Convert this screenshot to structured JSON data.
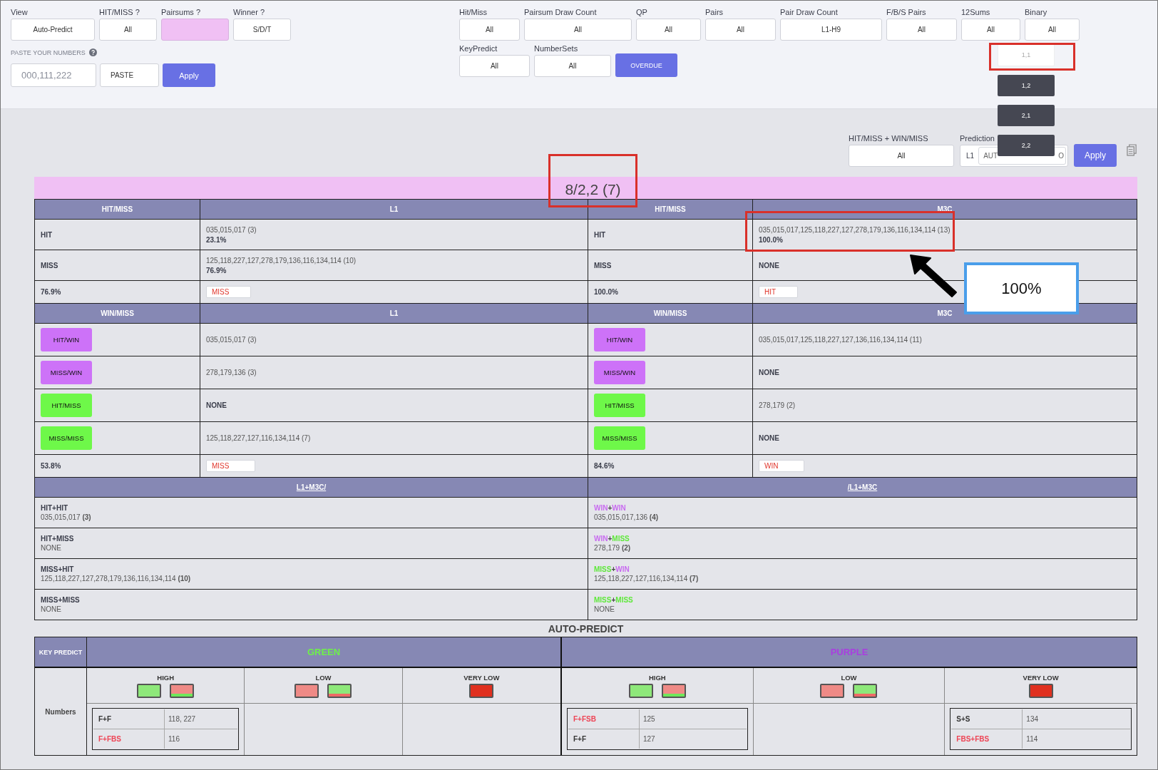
{
  "filters_left": [
    {
      "label": "View",
      "kind": "select",
      "value": "Auto-Predict"
    },
    {
      "label": "HIT/MISS ?",
      "kind": "select",
      "value": "All"
    },
    {
      "label": "Pairsums ?",
      "kind": "swatch"
    },
    {
      "label": "Winner ?",
      "kind": "select",
      "value": "S/D/T"
    }
  ],
  "paste": {
    "label": "PASTE YOUR NUMBERS",
    "placeholder": "000,111,222",
    "paste_button": "PASTE",
    "apply_button": "Apply"
  },
  "filters_right": [
    {
      "label": "Hit/Miss",
      "value": "All"
    },
    {
      "label": "Pairsum Draw Count",
      "value": "All"
    },
    {
      "label": "QP",
      "value": "All"
    },
    {
      "label": "Pairs",
      "value": "All"
    },
    {
      "label": "Pair Draw Count",
      "value": "L1-H9"
    },
    {
      "label": "F/B/S Pairs",
      "value": "All"
    },
    {
      "label": "12Sums",
      "value": "All"
    },
    {
      "label": "Binary",
      "value": "All"
    }
  ],
  "filters_right_row2": [
    {
      "label": "KeyPredict",
      "value": "All"
    },
    {
      "label": "NumberSets",
      "value": "All"
    }
  ],
  "overdue_button": "OVERDUE",
  "dropdown": {
    "options": [
      {
        "label": "1,1",
        "selected": true
      },
      {
        "label": "1,2",
        "selected": false
      },
      {
        "label": "2,1",
        "selected": false
      },
      {
        "label": "2,2",
        "selected": false
      }
    ]
  },
  "result_filter": {
    "label": "HIT/MISS + WIN/MISS",
    "value": "All"
  },
  "prediction": {
    "label": "Prediction",
    "prefix": "L1",
    "value_start": "AUT",
    "value_end": "O",
    "apply_button": "Apply"
  },
  "summary_title": "8/2,2 (7)",
  "sides": [
    {
      "hit_name": "L1",
      "win_name": "L1",
      "hit_header": "HIT/MISS",
      "hit_rows": [
        {
          "label": "HIT",
          "numbers": "035,015,017 (3)",
          "percent": "23.1%",
          "empty": false
        },
        {
          "label": "MISS",
          "numbers": "125,118,227,127,278,179,136,116,134,114 (10)",
          "percent": "76.9%",
          "empty": false
        }
      ],
      "hit_total": "76.9%",
      "hit_result": "MISS",
      "win_header": "WIN/MISS",
      "win_rows": [
        {
          "label": "HIT/WIN",
          "kind": "win",
          "numbers": "035,015,017 (3)",
          "empty": false
        },
        {
          "label": "MISS/WIN",
          "kind": "win",
          "numbers": "278,179,136 (3)",
          "empty": false
        },
        {
          "label": "HIT/MISS",
          "kind": "miss",
          "numbers": "NONE",
          "empty": true
        },
        {
          "label": "MISS/MISS",
          "kind": "miss",
          "numbers": "125,118,227,127,116,134,114 (7)",
          "empty": false
        }
      ],
      "win_total": "53.8%",
      "win_result": "MISS"
    },
    {
      "hit_name": "M3C",
      "win_name": "M3C",
      "hit_header": "HIT/MISS",
      "hit_rows": [
        {
          "label": "HIT",
          "numbers": "035,015,017,125,118,227,127,278,179,136,116,134,114 (13)",
          "percent": "100.0%",
          "empty": false
        },
        {
          "label": "MISS",
          "numbers": "NONE",
          "empty": true
        }
      ],
      "hit_total": "100.0%",
      "hit_result": "HIT",
      "win_header": "WIN/MISS",
      "win_rows": [
        {
          "label": "HIT/WIN",
          "kind": "win",
          "numbers": "035,015,017,125,118,227,127,136,116,134,114 (11)",
          "empty": false
        },
        {
          "label": "MISS/WIN",
          "kind": "win",
          "numbers": "NONE",
          "empty": true
        },
        {
          "label": "HIT/MISS",
          "kind": "miss",
          "numbers": "278,179 (2)",
          "empty": false
        },
        {
          "label": "MISS/MISS",
          "kind": "miss",
          "numbers": "NONE",
          "empty": true
        }
      ],
      "win_total": "84.6%",
      "win_result": "WIN"
    }
  ],
  "combo": {
    "left_header": "L1+M3C/",
    "right_header": "/L1+M3C",
    "left_rows": [
      {
        "label": "HIT+HIT",
        "numbers": "035,015,017 **(3)**"
      },
      {
        "label": "HIT+MISS",
        "numbers": "NONE"
      },
      {
        "label": "MISS+HIT",
        "numbers": "125,118,227,127,278,179,136,116,134,114 **(10)**"
      },
      {
        "label": "MISS+MISS",
        "numbers": "NONE"
      }
    ],
    "right_rows": [
      {
        "parts": [
          {
            "text": "WIN",
            "kind": "win"
          },
          {
            "text": "+",
            "kind": "plus"
          },
          {
            "text": "WIN",
            "kind": "win"
          }
        ],
        "numbers": "035,015,017,136 **(4)**"
      },
      {
        "parts": [
          {
            "text": "WIN",
            "kind": "win"
          },
          {
            "text": "+",
            "kind": "plus"
          },
          {
            "text": "MISS",
            "kind": "miss"
          }
        ],
        "numbers": "278,179 **(2)**"
      },
      {
        "parts": [
          {
            "text": "MISS",
            "kind": "miss"
          },
          {
            "text": "+",
            "kind": "plus"
          },
          {
            "text": "WIN",
            "kind": "win"
          }
        ],
        "numbers": "125,118,227,127,116,134,114 **(7)**"
      },
      {
        "parts": [
          {
            "text": "MISS",
            "kind": "miss"
          },
          {
            "text": "+",
            "kind": "plus"
          },
          {
            "text": "MISS",
            "kind": "miss"
          }
        ],
        "numbers": "NONE"
      }
    ]
  },
  "auto_predict": {
    "title": "AUTO-PREDICT",
    "key_header": "KEY PREDICT",
    "row_label": "Numbers",
    "groups": [
      {
        "name": "GREEN",
        "color": "#6ef04a",
        "levels": [
          {
            "label": "HIGH",
            "swatches": [
              {
                "kind": "green"
              },
              {
                "kind": "red_low"
              }
            ],
            "entries": [
              {
                "code": "F+F",
                "alert": false,
                "numbers": "118, 227"
              },
              {
                "code": "F+FBS",
                "alert": true,
                "numbers": "116"
              }
            ]
          },
          {
            "label": "LOW",
            "swatches": [
              {
                "kind": "red"
              },
              {
                "kind": "green_low"
              }
            ]
          },
          {
            "label": "VERY LOW",
            "swatches": [
              {
                "kind": "dark_red"
              }
            ]
          }
        ]
      },
      {
        "name": "PURPLE",
        "color": "#a93ee0",
        "levels": [
          {
            "label": "HIGH",
            "swatches": [
              {
                "kind": "green"
              },
              {
                "kind": "red_low"
              }
            ],
            "entries": [
              {
                "code": "F+FSB",
                "alert": true,
                "numbers": "125"
              },
              {
                "code": "F+F",
                "alert": false,
                "numbers": "127"
              }
            ]
          },
          {
            "label": "LOW",
            "swatches": [
              {
                "kind": "red"
              },
              {
                "kind": "green_low"
              }
            ]
          },
          {
            "label": "VERY LOW",
            "swatches": [
              {
                "kind": "dark_red"
              }
            ],
            "entries": [
              {
                "code": "S+S",
                "alert": false,
                "numbers": "134"
              },
              {
                "code": "FBS+FBS",
                "alert": true,
                "numbers": "114"
              }
            ]
          }
        ]
      }
    ]
  },
  "callout": {
    "text": "100%"
  }
}
